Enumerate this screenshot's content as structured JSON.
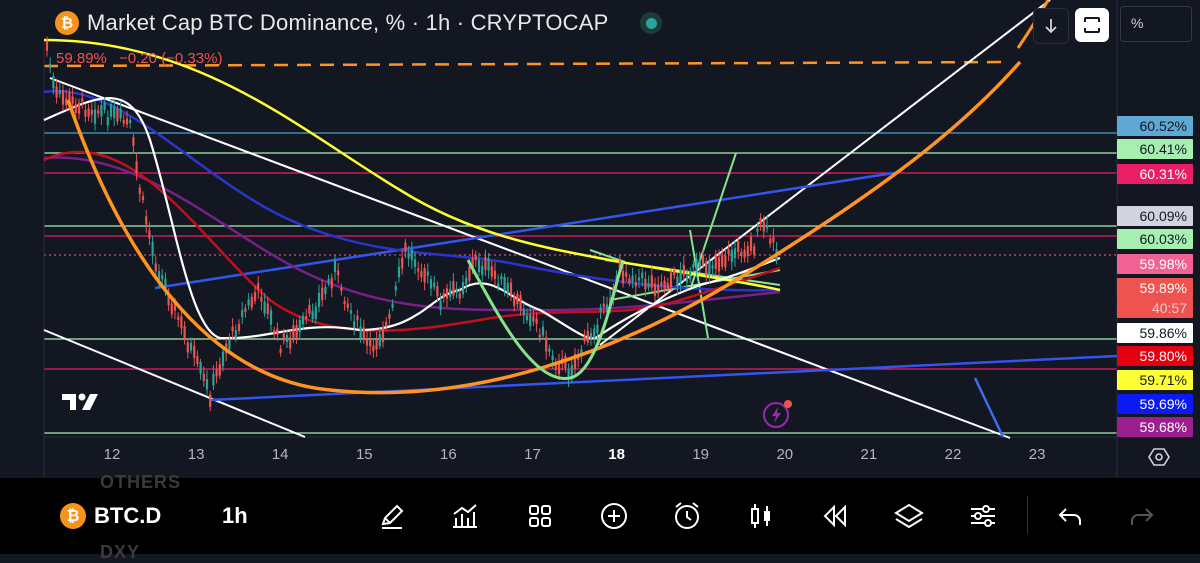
{
  "header": {
    "title": "Market Cap BTC Dominance, % · 1h · CRYPTOCAP",
    "logo_glyph": "₿",
    "price": "59.89%",
    "change": "−0.20 (−0.33%)",
    "scale_mode": "%",
    "down_icon": "arrow-down-icon",
    "expand_icon": "fullscreen-icon"
  },
  "price_labels": [
    {
      "text": "60.52%",
      "bg": "#5fa8d3",
      "color": "#131722"
    },
    {
      "text": "60.41%",
      "bg": "#a5f0b0",
      "color": "#131722"
    },
    {
      "text": "60.31%",
      "bg": "#e91e63",
      "color": "#ffffff"
    },
    {
      "text": "60.09%",
      "bg": "#d1d4dc",
      "color": "#131722"
    },
    {
      "text": "60.03%",
      "bg": "#a5f0b0",
      "color": "#131722"
    },
    {
      "text": "59.98%",
      "bg": "#f06292",
      "color": "#ffffff"
    },
    {
      "text": "59.89%",
      "bg": "#ef5350",
      "color": "#ffffff"
    },
    {
      "text": "40:57",
      "bg": "#ef5350",
      "color": "#f8c8c8"
    },
    {
      "text": "59.86%",
      "bg": "#ffffff",
      "color": "#131722"
    },
    {
      "text": "59.80%",
      "bg": "#e3000f",
      "color": "#ffffff"
    },
    {
      "text": "59.71%",
      "bg": "#ffff33",
      "color": "#131722"
    },
    {
      "text": "59.69%",
      "bg": "#0a1af0",
      "color": "#ffffff"
    },
    {
      "text": "59.68%",
      "bg": "#9c1f8f",
      "color": "#ffffff"
    }
  ],
  "x_axis": [
    "12",
    "13",
    "14",
    "15",
    "16",
    "17",
    "18",
    "19",
    "20",
    "21",
    "22",
    "23"
  ],
  "x_axis_bold": "18",
  "toolbar": {
    "symbol": "BTC.D",
    "interval": "1h",
    "ghost_top": "OTHERS",
    "ghost_bottom": "DXY",
    "icons": [
      "draw-icon",
      "indicators-icon",
      "layouts-icon",
      "add-icon",
      "alert-icon",
      "chart-type-icon",
      "replay-icon",
      "layers-icon",
      "settings-sliders-icon",
      "undo-icon",
      "redo-icon"
    ]
  },
  "colors": {
    "background": "#131722",
    "up": "#26a69a",
    "down": "#ef5350",
    "orange": "#ff9422",
    "green_line": "#86e38c"
  }
}
